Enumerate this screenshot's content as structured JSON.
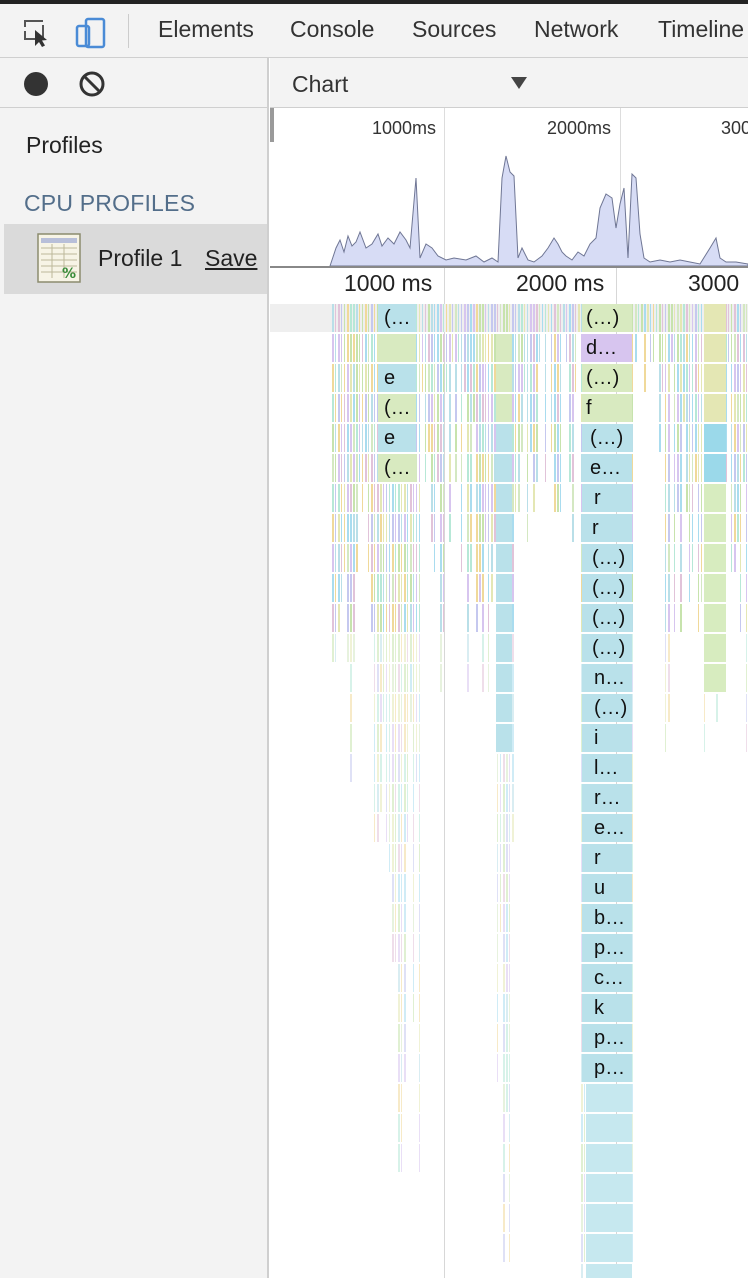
{
  "devtools": {
    "tabs": [
      "Elements",
      "Console",
      "Sources",
      "Network",
      "Timeline"
    ],
    "colors": {
      "accent": "#4a8bd6",
      "heading": "#536e8a"
    }
  },
  "sidebar": {
    "profiles_label": "Profiles",
    "section_heading": "CPU PROFILES",
    "profile_name": "Profile 1",
    "save_label": "Save"
  },
  "view_select": {
    "value": "Chart"
  },
  "overview": {
    "ticks": [
      "1000ms",
      "2000ms",
      "300"
    ]
  },
  "flame": {
    "ticks": [
      "1000 ms",
      "2000 ms",
      "3000"
    ],
    "labels_left": [
      "(…",
      "e",
      "(…",
      "e",
      "(…"
    ],
    "labels_middle": [
      "(…)",
      "d…",
      "(…)",
      "f",
      "(…)",
      "e…",
      "r",
      "r",
      "(…)",
      "(…)",
      "(…)",
      "(…)",
      "n…",
      "(…)",
      "i",
      "l…",
      "r…",
      "e…",
      "r",
      "u",
      "b…",
      "p…",
      "c…",
      "k",
      "p…",
      "p…"
    ]
  }
}
